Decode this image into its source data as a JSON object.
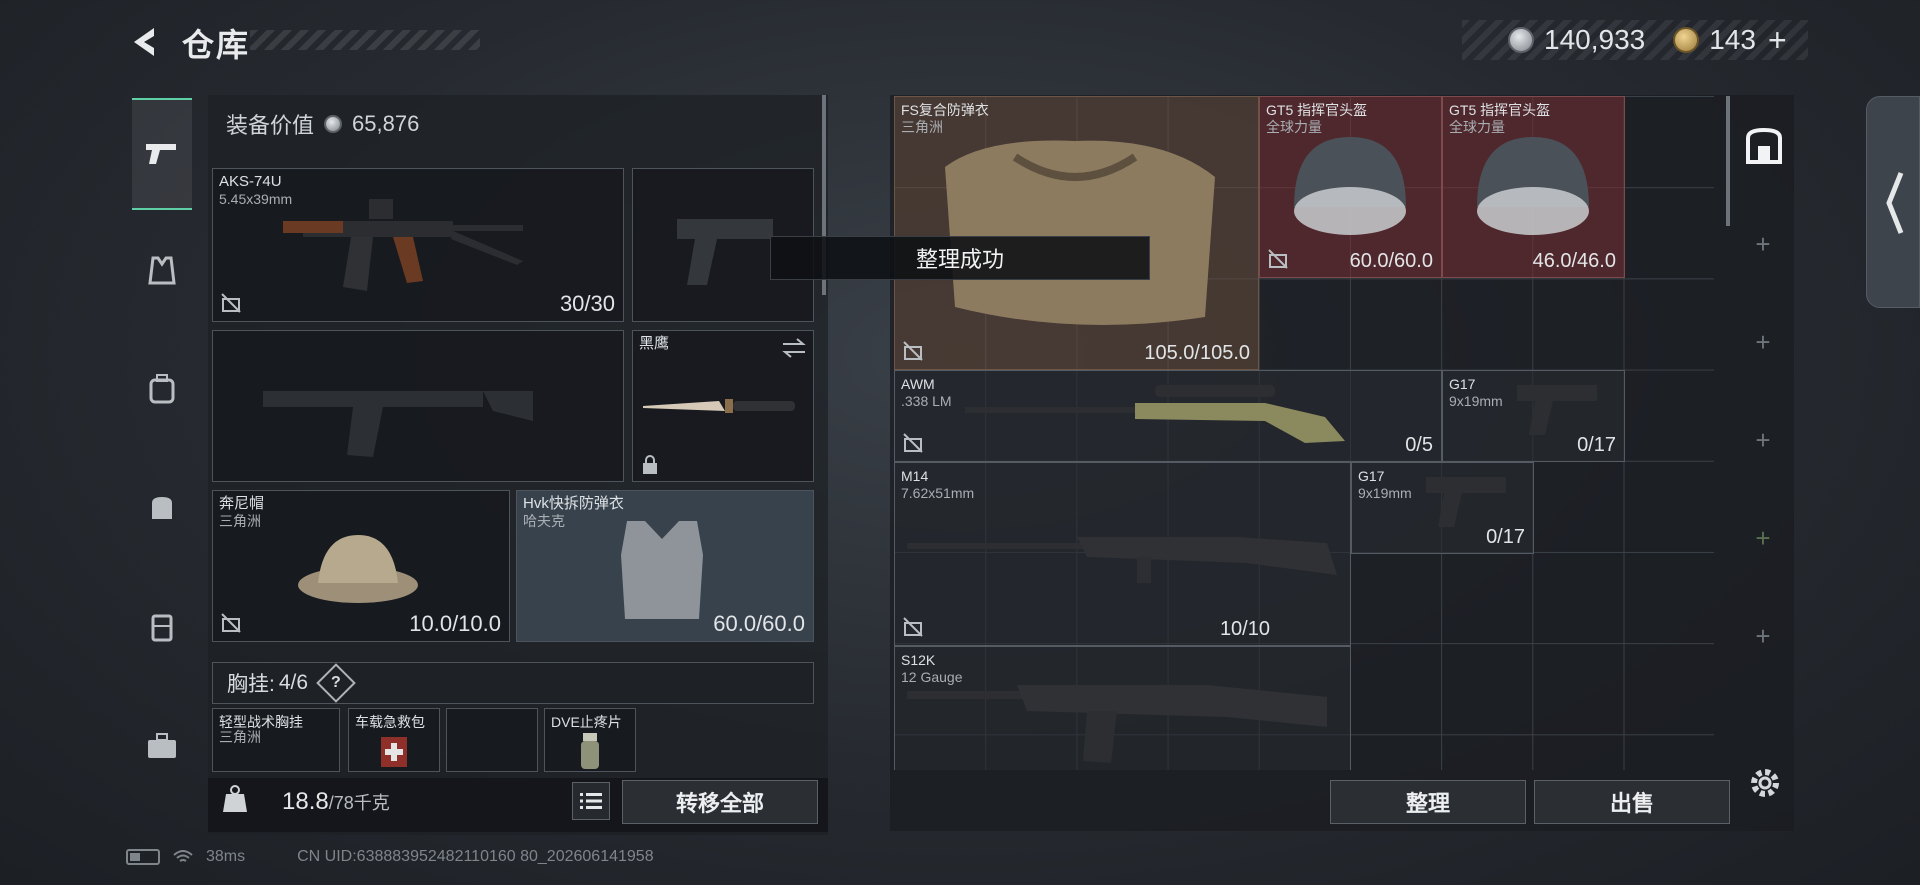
{
  "header": {
    "title": "仓库",
    "currency_primary": "140,933",
    "currency_secondary": "143",
    "add_label": "+"
  },
  "equipment": {
    "value_label": "装备价值",
    "value": "65,876",
    "primary_weapon": {
      "name": "AKS-74U",
      "caliber": "5.45x39mm",
      "ammo": "30/30"
    },
    "knife": {
      "name": "黑鹰"
    },
    "helmet": {
      "name": "奔尼帽",
      "brand": "三角洲",
      "durability": "10.0/10.0"
    },
    "armor": {
      "name": "Hvk快拆防弹衣",
      "brand": "哈夫克",
      "durability": "60.0/60.0"
    },
    "chest_rig": {
      "label": "胸挂:",
      "capacity": "4/6",
      "help": "?"
    },
    "rig_items": [
      {
        "name": "轻型战术胸挂",
        "brand": "三角洲"
      },
      {
        "name": "车载急救包",
        "brand": ""
      },
      {
        "name": "",
        "brand": ""
      },
      {
        "name": "DVE止疼片",
        "brand": ""
      }
    ]
  },
  "weight": {
    "current": "18.8",
    "max": "/78千克"
  },
  "buttons": {
    "transfer_all": "转移全部",
    "sort": "整理",
    "sell": "出售"
  },
  "toast": "整理成功",
  "storage": [
    {
      "name": "FS复合防弹衣",
      "sub": "三角洲",
      "count": "105.0/105.0"
    },
    {
      "name": "GT5 指挥官头盔",
      "sub": "全球力量",
      "count": "60.0/60.0"
    },
    {
      "name": "GT5 指挥官头盔",
      "sub": "全球力量",
      "count": "46.0/46.0"
    },
    {
      "name": "AWM",
      "sub": ".338 LM",
      "count": "0/5"
    },
    {
      "name": "G17",
      "sub": "9x19mm",
      "count": "0/17"
    },
    {
      "name": "M14",
      "sub": "7.62x51mm",
      "count": "10/10"
    },
    {
      "name": "G17",
      "sub": "9x19mm",
      "count": "0/17"
    },
    {
      "name": "S12K",
      "sub": "12 Gauge",
      "count": ""
    }
  ],
  "status": {
    "ping": "38ms",
    "uid": "CN UID:638883952482110160 80_202606141958"
  },
  "colors": {
    "accent": "#5fd0a6",
    "red_item": "#783034"
  }
}
